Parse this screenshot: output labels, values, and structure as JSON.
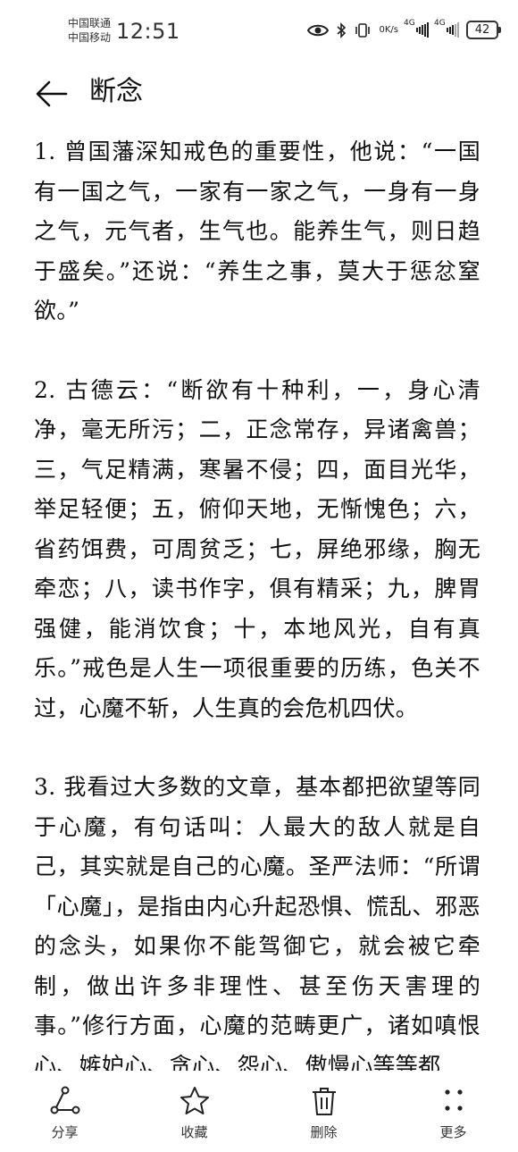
{
  "status_bar": {
    "carrier1": "中国联通",
    "carrier2": "中国移动",
    "time": "12:51",
    "speed_value": "0",
    "speed_unit": "K/s",
    "signal1_label": "4G",
    "signal2_label": "4G",
    "battery": "42"
  },
  "header": {
    "title": "断念"
  },
  "article": {
    "paragraphs": [
      "1. 曾国藩深知戒色的重要性，他说：“一国有一国之气，一家有一家之气，一身有一身之气，元气者，生气也。能养生气，则日趋于盛矣。”还说：“养生之事，莫大于惩忿窒欲。”",
      "2. 古德云：“断欲有十种利，一，身心清净，毫无所污；二，正念常存，异诸禽兽；三，气足精满，寒暑不侵；四，面目光华，举足轻便；五，俯仰天地，无惭愧色；六，省药饵费，可周贫乏；七，屏绝邪缘，胸无牵恋；八，读书作字，俱有精采；九，脾胃强健，能消饮食；十，本地风光，自有真乐。”戒色是人生一项很重要的历练，色关不过，心魔不斩，人生真的会危机四伏。",
      "3. 我看过大多数的文章，基本都把欲望等同于心魔，有句话叫：人最大的敌人就是自己，其实就是自己的心魔。圣严法师：“所谓「心魔」，是指由内心升起恐惧、慌乱、邪恶的念头，如果你不能驾御它，就会被它牵制，做出许多非理性、甚至伤天害理的事。”修行方面，心魔的范畴更广，诸如嗔恨心、嫉妒心、贪心、怨心、傲慢心等等都"
    ]
  },
  "toolbar": {
    "share": {
      "label": "分享",
      "icon": "share-icon"
    },
    "favorite": {
      "label": "收藏",
      "icon": "star-icon"
    },
    "delete": {
      "label": "删除",
      "icon": "trash-icon"
    },
    "more": {
      "label": "更多",
      "icon": "more-dots-icon"
    }
  }
}
